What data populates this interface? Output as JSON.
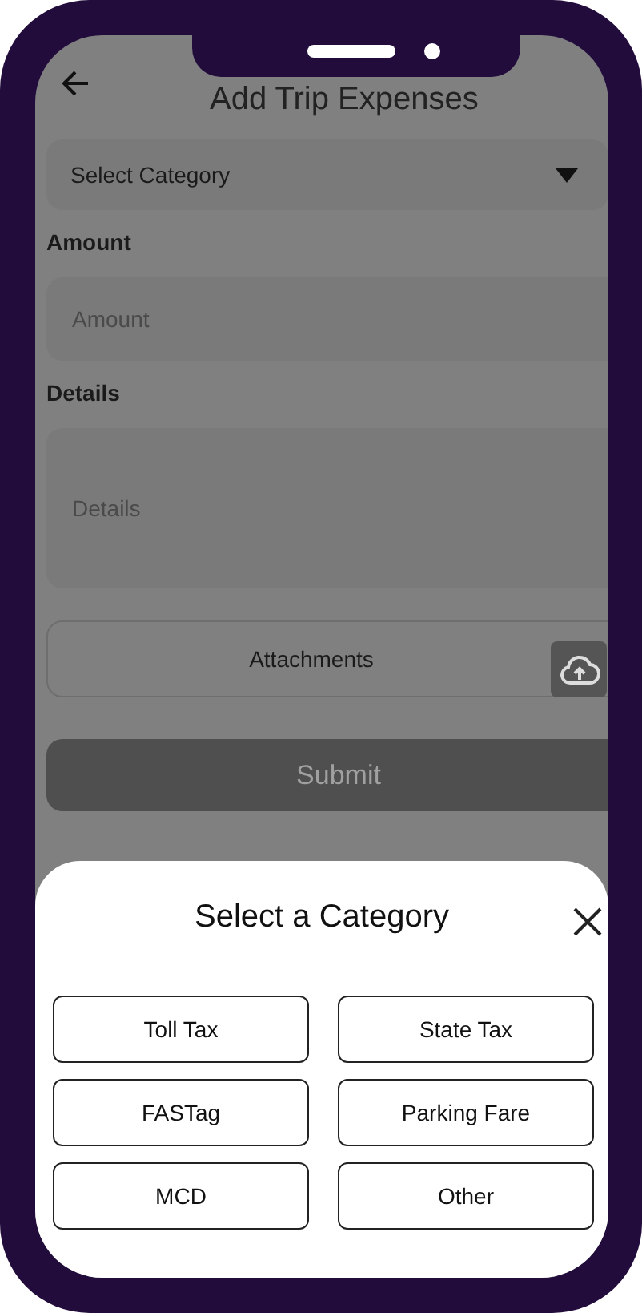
{
  "header": {
    "title": "Add Trip Expenses"
  },
  "category_field": {
    "value": "Select Category"
  },
  "amount": {
    "label": "Amount",
    "placeholder": "Amount"
  },
  "details": {
    "label": "Details",
    "placeholder": "Details"
  },
  "attachments": {
    "label": "Attachments"
  },
  "submit": {
    "label": "Submit",
    "disabled": true
  },
  "sheet": {
    "title": "Select a Category",
    "options": [
      "Toll Tax",
      "State Tax",
      "FASTag",
      "Parking Fare",
      "MCD",
      "Other"
    ]
  }
}
